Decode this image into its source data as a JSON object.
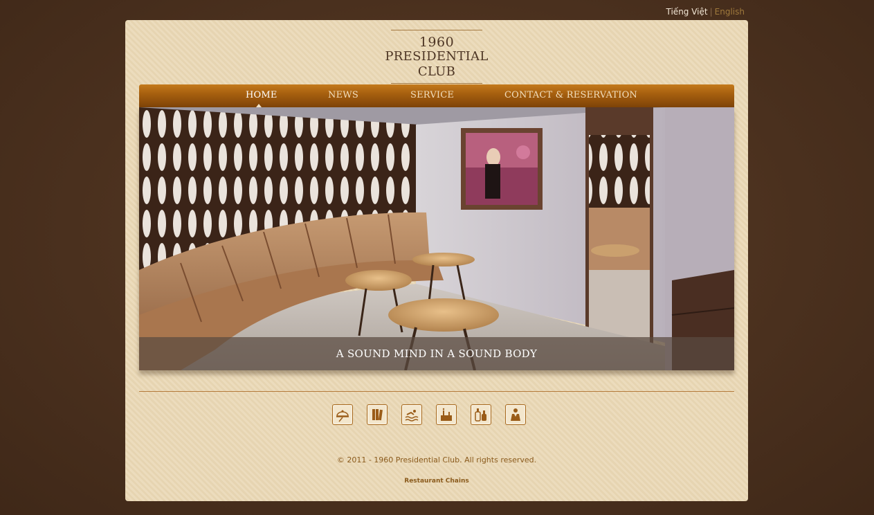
{
  "language_switch": {
    "vietnamese": "Tiếng Việt",
    "separator": "|",
    "english": "English"
  },
  "logo": {
    "year": "1960",
    "name": "PRESIDENTIAL CLUB"
  },
  "nav": {
    "items": [
      {
        "label": "HOME",
        "active": true
      },
      {
        "label": "NEWS",
        "active": false
      },
      {
        "label": "SERVICE",
        "active": false
      },
      {
        "label": "CONTACT & RESERVATION",
        "active": false
      }
    ]
  },
  "hero": {
    "caption": "A SOUND MIND IN A SOUND BODY"
  },
  "service_icons": [
    "waiter-tray-icon",
    "library-books-icon",
    "swimming-pool-icon",
    "cake-candles-icon",
    "wine-bottles-icon",
    "butler-icon"
  ],
  "footer": {
    "copyright": "© 2011 - 1960 Presidential Club. All rights reserved.",
    "link": "Restaurant Chains"
  },
  "colors": {
    "accent": "#a7600f",
    "text": "#8a5a1c",
    "background": "#4e3320",
    "panel": "#ecdcbd"
  }
}
